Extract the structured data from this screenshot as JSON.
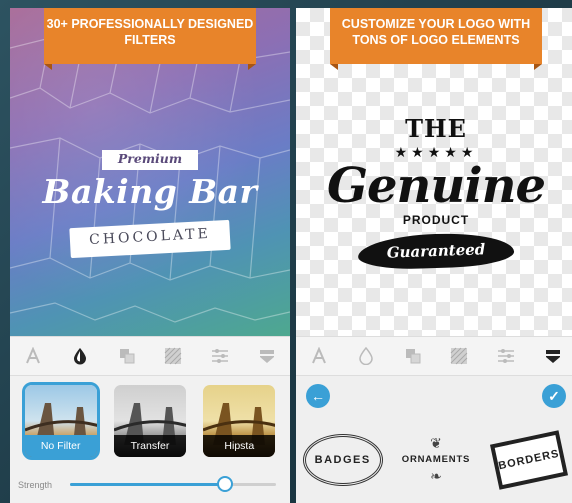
{
  "left_panel": {
    "banner": "30+ PROFESSIONALLY DESIGNED FILTERS",
    "logo": {
      "top": "Premium",
      "main": "Baking Bar",
      "ribbon": "CHOCOLATE"
    },
    "toolbar": [
      "text-icon",
      "drop-icon",
      "layers-icon",
      "texture-icon",
      "sliders-icon",
      "badge-icon"
    ],
    "filters": [
      {
        "label": "No Filter",
        "selected": true
      },
      {
        "label": "Transfer",
        "selected": false
      },
      {
        "label": "Hipsta",
        "selected": false
      }
    ],
    "strength_label": "Strength",
    "strength_value": 0.75
  },
  "right_panel": {
    "banner": "CUSTOMIZE YOUR LOGO WITH TONS OF LOGO ELEMENTS",
    "logo": {
      "top": "THE",
      "stars": "★★★★★",
      "main": "Genuine",
      "sub": "PRODUCT",
      "ribbon": "Guaranteed"
    },
    "toolbar": [
      "text-icon",
      "drop-icon",
      "layers-icon",
      "texture-icon",
      "sliders-icon",
      "badge-icon"
    ],
    "elements": [
      {
        "label": "BADGES"
      },
      {
        "label": "ORNAMENTS"
      },
      {
        "label": "BORDERS"
      }
    ]
  },
  "colors": {
    "accent": "#3aa0d6",
    "banner": "#e8842a",
    "background": "#1d3945"
  }
}
